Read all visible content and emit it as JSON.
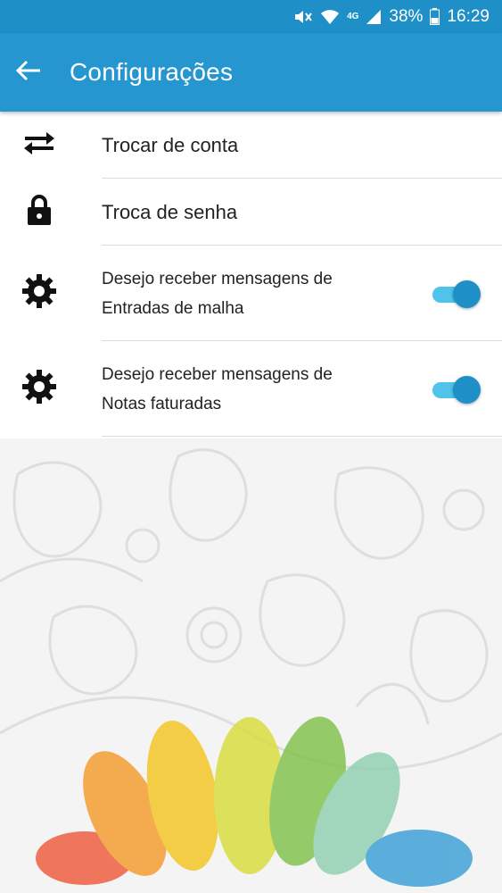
{
  "status_bar": {
    "network": "4G",
    "battery": "38%",
    "time": "16:29"
  },
  "header": {
    "title": "Configurações",
    "back_icon": "arrow-left-icon"
  },
  "settings": [
    {
      "label": "Trocar de conta",
      "icon": "swap-arrows-icon"
    },
    {
      "label": "Troca de senha",
      "icon": "lock-icon"
    },
    {
      "label_line1": "Desejo receber mensagens de",
      "label_line2": "Entradas de malha",
      "icon": "gear-icon",
      "enabled": true
    },
    {
      "label_line1": "Desejo receber mensagens de",
      "label_line2": "Notas faturadas",
      "icon": "gear-icon",
      "enabled": true
    }
  ],
  "colors": {
    "status_bar": "#1f8fc8",
    "app_bar": "#2596cf",
    "switch_track": "#4fc3ea",
    "switch_thumb": "#1f8fc8"
  }
}
